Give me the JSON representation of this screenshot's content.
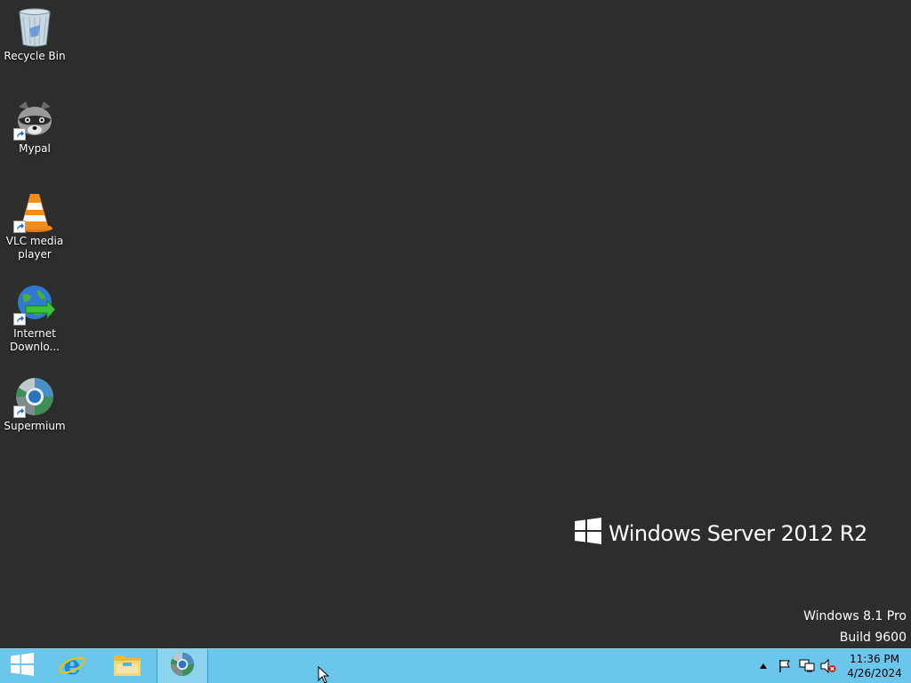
{
  "desktop": {
    "icons": [
      {
        "label": "Recycle Bin"
      },
      {
        "label": "Mypal"
      },
      {
        "label": "VLC media player"
      },
      {
        "label": "Internet Downlo..."
      },
      {
        "label": "Supermium"
      }
    ]
  },
  "branding": {
    "text": "Windows Server 2012 R2"
  },
  "watermark": {
    "edition": "Windows 8.1 Pro",
    "build": "Build 9600"
  },
  "taskbar": {
    "pinned": [
      {
        "name": "Internet Explorer",
        "icon": "ie-icon"
      },
      {
        "name": "File Explorer",
        "icon": "folder-icon"
      },
      {
        "name": "Supermium",
        "icon": "supermium-icon"
      }
    ],
    "tray": {
      "time": "11:36 PM",
      "date": "4/26/2024"
    }
  },
  "colors": {
    "desktop_bg": "#2d2d2d",
    "taskbar_bg": "#6ac6ea"
  }
}
